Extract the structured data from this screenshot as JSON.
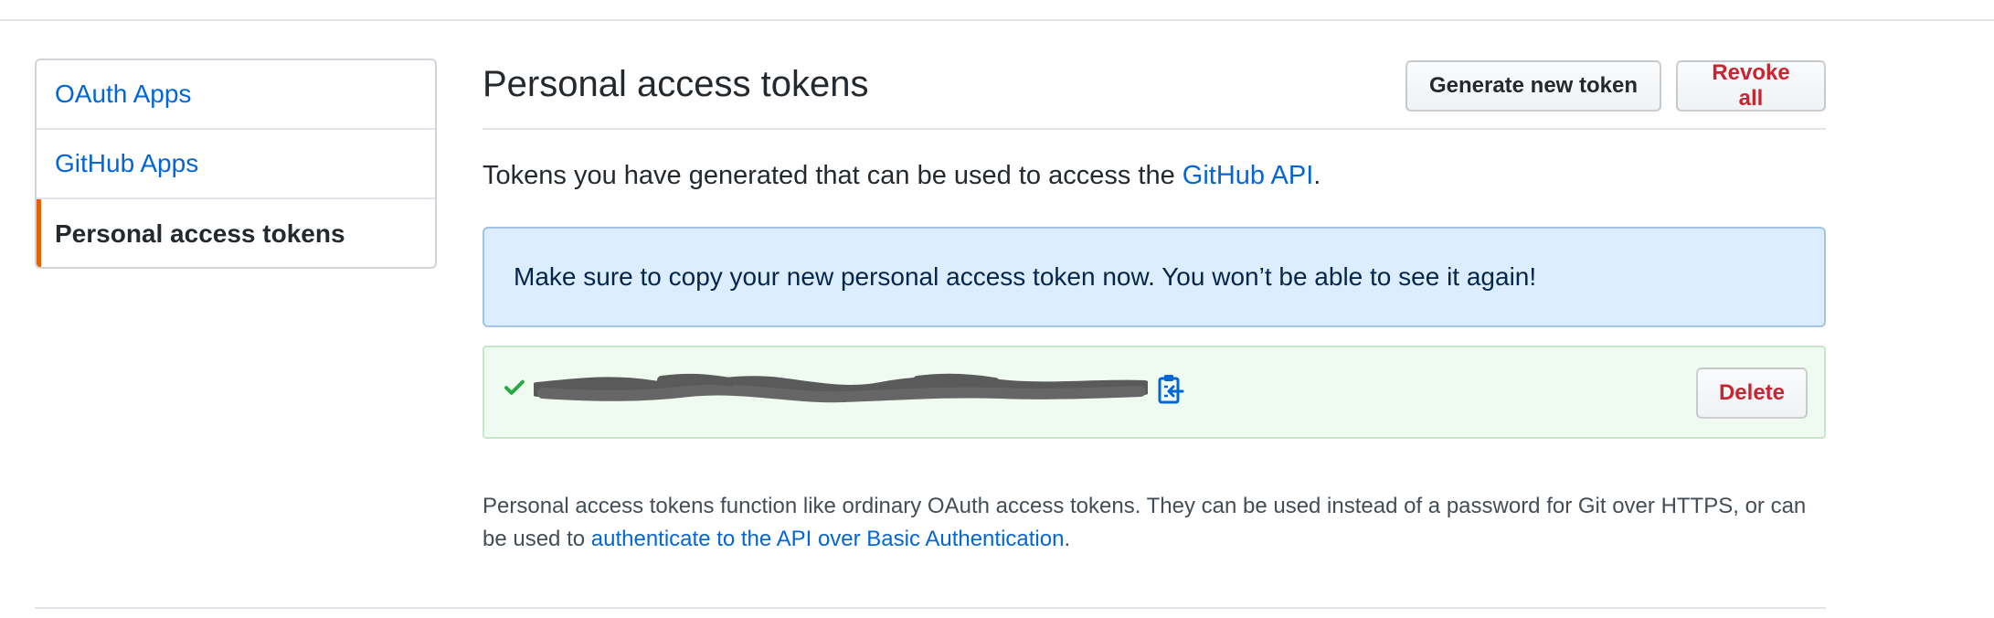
{
  "sidebar": {
    "items": [
      {
        "label": "OAuth Apps"
      },
      {
        "label": "GitHub Apps"
      },
      {
        "label": "Personal access tokens"
      }
    ]
  },
  "header": {
    "title": "Personal access tokens",
    "generate_label": "Generate new token",
    "revoke_label": "Revoke all"
  },
  "intro": {
    "text": "Tokens you have generated that can be used to access the ",
    "link": "GitHub API",
    "suffix": "."
  },
  "flash": {
    "message": "Make sure to copy your new personal access token now. You won’t be able to see it again!"
  },
  "token": {
    "value": "",
    "delete_label": "Delete",
    "icons": [
      "check-icon",
      "clippy-icon"
    ]
  },
  "note": {
    "text": "Personal access tokens function like ordinary OAuth access tokens. They can be used instead of a password for Git over HTTPS, or can be used to ",
    "link": "authenticate to the API over Basic Authentication",
    "suffix": "."
  },
  "colors": {
    "link": "#0366d6",
    "danger": "#cb2431",
    "selected_accent": "#e36209",
    "flash_bg": "#dbedff",
    "success_bg": "#effbf0",
    "success_icon": "#28a745"
  }
}
